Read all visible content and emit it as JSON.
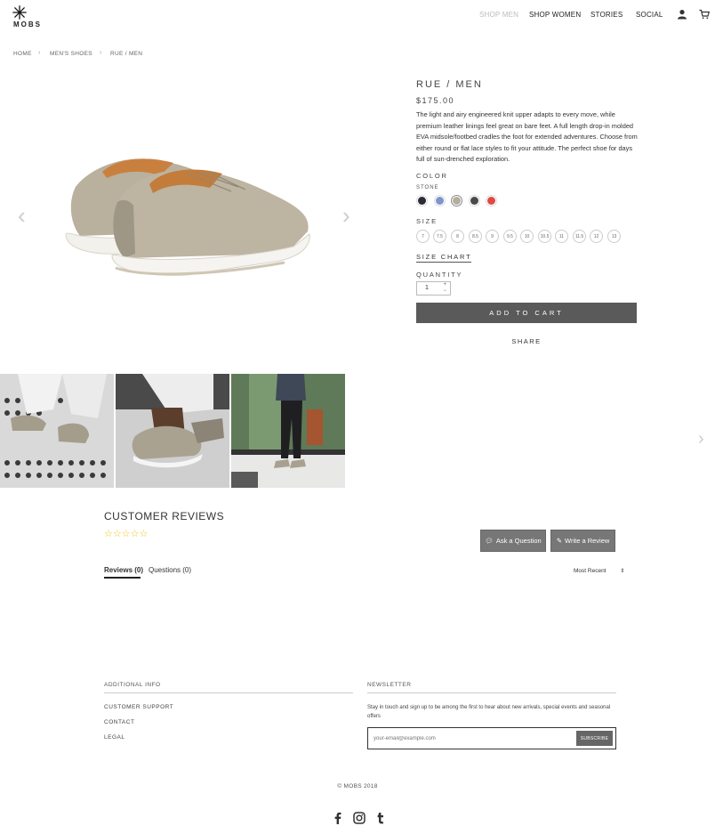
{
  "brand": {
    "name": "MOBS"
  },
  "nav": {
    "items": [
      {
        "label": "SHOP MEN"
      },
      {
        "label": "SHOP WOMEN"
      },
      {
        "label": "STORIES"
      },
      {
        "label": "SOCIAL"
      }
    ],
    "account_icon": "user-icon",
    "cart_icon": "cart-icon"
  },
  "breadcrumb": [
    "HOME",
    "MEN'S SHOES",
    "RUE / MEN"
  ],
  "product": {
    "title": "RUE / MEN",
    "price": "$175.00",
    "description": "The light and airy engineered knit upper adapts to every move, while premium leather linings feel great on bare feet. A full length drop-in molded EVA midsole/footbed cradles the foot for extended adventures. Choose from either round or flat lace styles to fit your attitude. The perfect shoe for days full of sun-drenched exploration.",
    "color_label": "COLOR",
    "selected_color": "STONE",
    "colors": [
      {
        "hex": "#2a2b36"
      },
      {
        "hex": "#7f93cf"
      },
      {
        "hex": "#b5ae9f"
      },
      {
        "hex": "#4a4a4a"
      },
      {
        "hex": "#e04a45"
      }
    ],
    "size_label": "SIZE",
    "sizes": [
      "7",
      "7.5",
      "8",
      "8.5",
      "9",
      "9.5",
      "10",
      "10.5",
      "11",
      "11.5",
      "12",
      "13"
    ],
    "size_chart_label": "SIZE CHART",
    "quantity_label": "QUANTITY",
    "quantity": "1",
    "add_to_cart_label": "ADD TO CART",
    "share_label": "SHARE"
  },
  "reviews": {
    "title": "CUSTOMER REVIEWS",
    "stars": "☆☆☆☆☆",
    "ask_label": "Ask a Question",
    "write_label": "Write a Review",
    "tabs": [
      {
        "label": "Reviews (0)"
      },
      {
        "label": "Questions (0)"
      }
    ],
    "sort_label": "Most Recent"
  },
  "footer": {
    "info_heading": "ADDITIONAL INFO",
    "links": [
      {
        "label": "CUSTOMER SUPPORT"
      },
      {
        "label": "CONTACT"
      },
      {
        "label": "LEGAL"
      }
    ],
    "newsletter_heading": "NEWSLETTER",
    "newsletter_text": "Stay in touch and sign up to be among the first to hear about new arrivals, special events and seasonal offers",
    "email_placeholder": "your-email@example.com",
    "subscribe_label": "SUBSCRIBE",
    "copyright": "© MOBS 2018",
    "social_icons": [
      "facebook-icon",
      "instagram-icon",
      "tumblr-icon"
    ]
  },
  "colors": {
    "accent_button": "#5a5a5a",
    "star": "#f0c419"
  }
}
